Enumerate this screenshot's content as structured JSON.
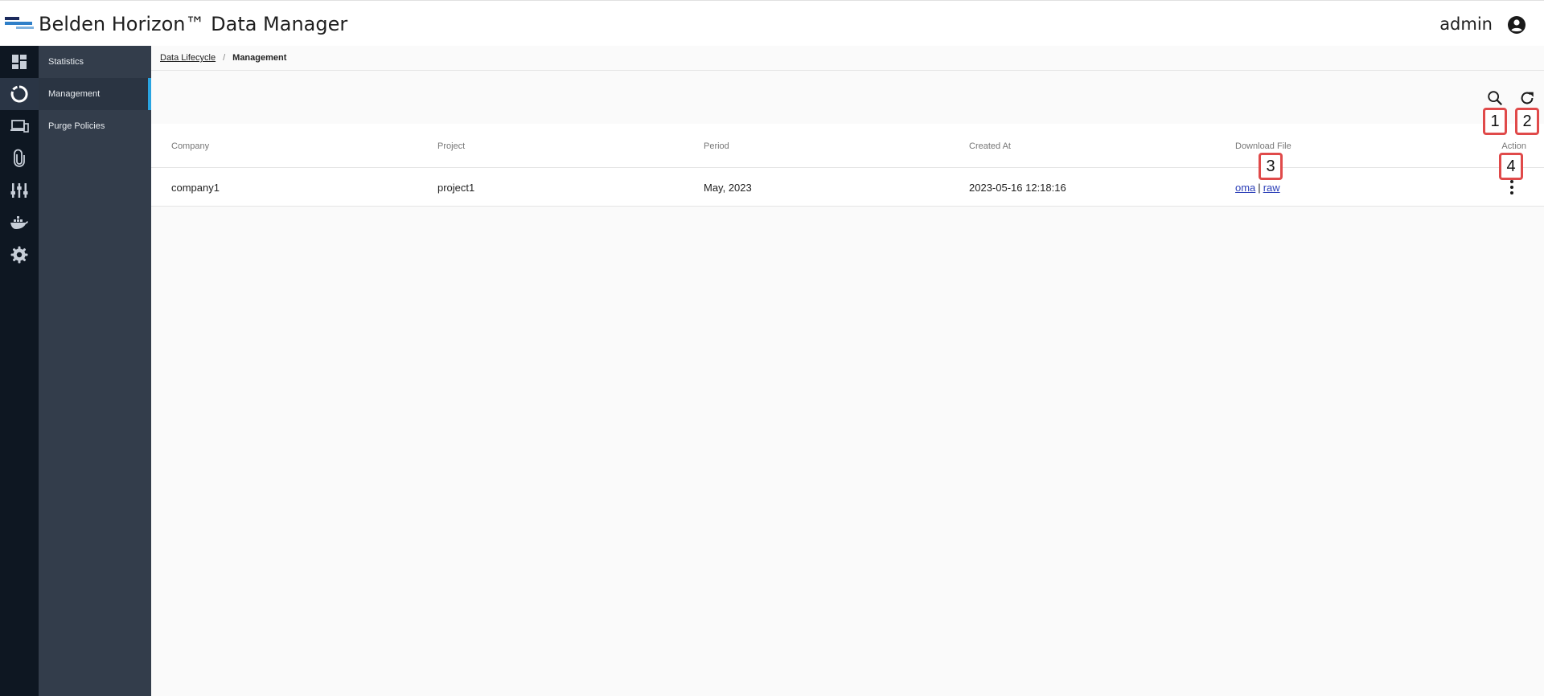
{
  "header": {
    "title": "Belden Horizon™ Data Manager",
    "user_name": "admin"
  },
  "rail": {
    "icons": [
      "dashboard-icon",
      "lifecycle-icon",
      "devices-icon",
      "attachment-icon",
      "equalizer-icon",
      "docker-icon",
      "gear-icon"
    ],
    "active_index": 1
  },
  "subnav": {
    "items": [
      {
        "label": "Statistics"
      },
      {
        "label": "Management"
      },
      {
        "label": "Purge Policies"
      }
    ],
    "active_index": 1
  },
  "breadcrumb": {
    "parent": "Data Lifecycle",
    "separator": "/",
    "current": "Management"
  },
  "toolbar": {
    "search_icon": "search-icon",
    "refresh_icon": "refresh-icon"
  },
  "markers": [
    "1",
    "2",
    "3",
    "4"
  ],
  "table": {
    "columns": [
      "Company",
      "Project",
      "Period",
      "Created At",
      "Download File",
      "Action"
    ],
    "rows": [
      {
        "company": "company1",
        "project": "project1",
        "period": "May, 2023",
        "created_at": "2023-05-16 12:18:16",
        "downloads": [
          "oma",
          "raw"
        ],
        "download_sep": "|"
      }
    ]
  },
  "colors": {
    "rail_bg": "#0e1722",
    "subnav_bg": "#333d4b",
    "accent": "#29a3e0",
    "link": "#2c3fb8",
    "marker_border": "#e04a4a"
  }
}
